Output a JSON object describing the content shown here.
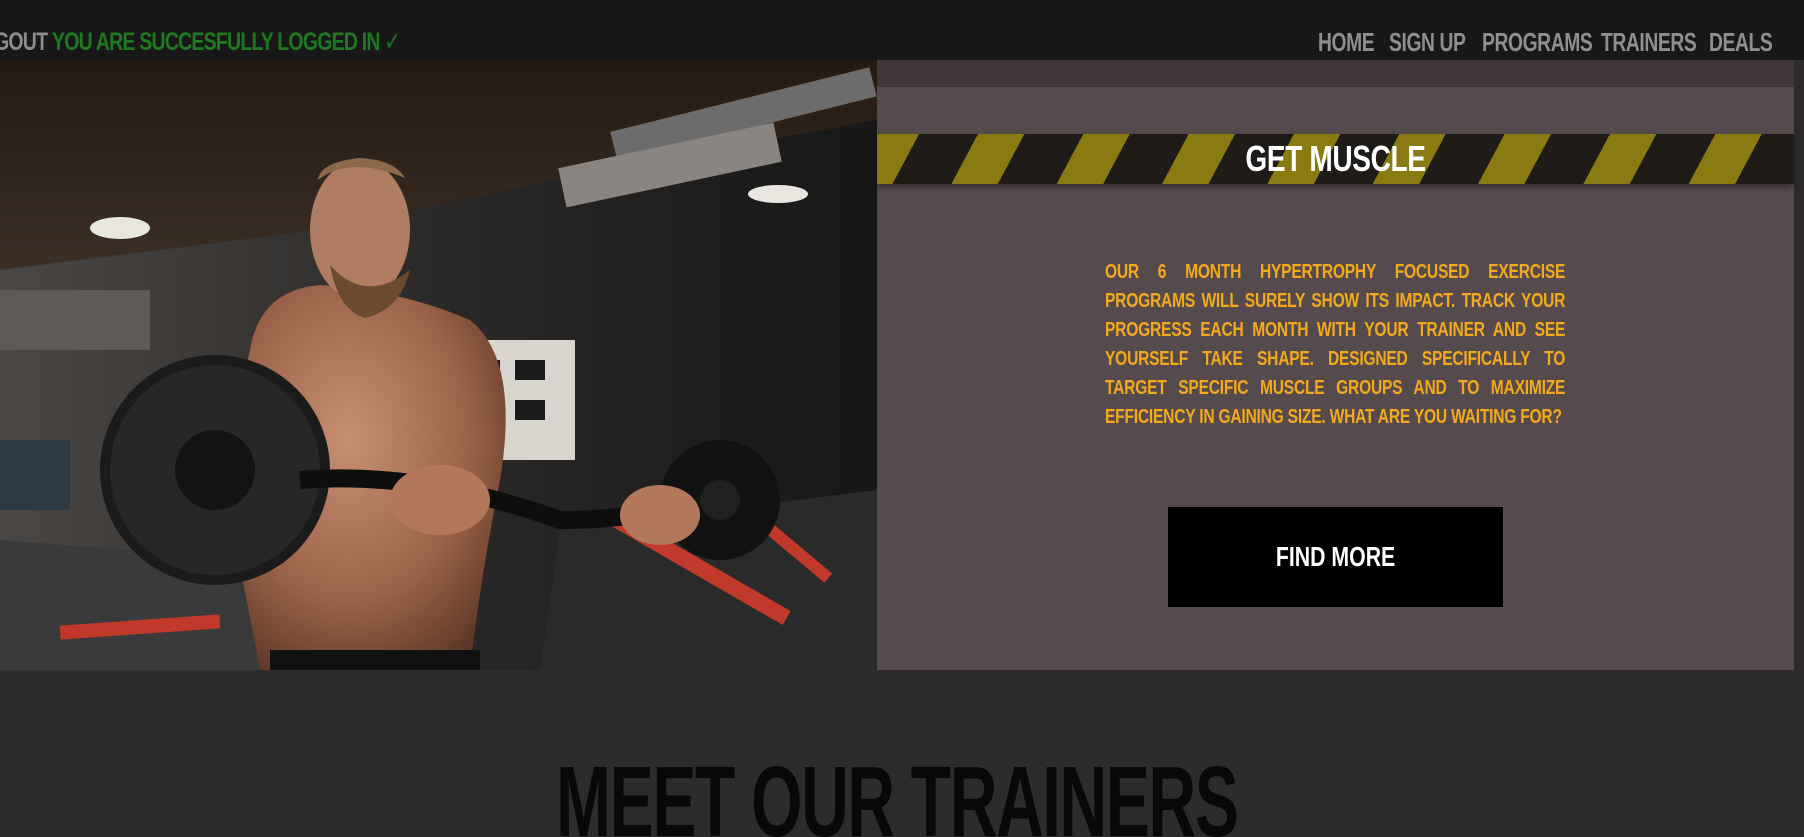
{
  "topbar": {
    "logout_label": "GOUT",
    "status_message": "YOU ARE SUCCESFULLY LOGGED IN ✓"
  },
  "nav": {
    "items": [
      {
        "label": "HOME"
      },
      {
        "label": "SIGN UP"
      },
      {
        "label": "PROGRAMS"
      },
      {
        "label": "TRAINERS"
      },
      {
        "label": "DEALS"
      }
    ]
  },
  "hero": {
    "image_subject": "man doing barbell curls in gym",
    "title": "GET MUSCLE",
    "description": "OUR 6 MONTH HYPERTROPHY FOCUSED EXERCISE PROGRAMS WILL SURELY SHOW ITS IMPACT. TRACK YOUR PROGRESS EACH MONTH WITH YOUR TRAINER AND SEE YOURSELF TAKE SHAPE. DESIGNED SPECIFICALLY TO TARGET SPECIFIC MUSCLE GROUPS AND TO MAXIMIZE EFFICIENCY IN GAINING SIZE. WHAT ARE YOU WAITING FOR?",
    "button_label": "FIND MORE"
  },
  "section": {
    "title": "MEET OUR TRAINERS"
  },
  "colors": {
    "topbar_bg": "#181818",
    "status_green": "#1f7a1f",
    "nav_grey": "#8f8f8f",
    "panel_bg": "#564b4c",
    "stripe_yellow": "#8a7a12",
    "body_orange": "#f3a91e",
    "button_bg": "#000000",
    "page_bg": "#2e2b2d"
  }
}
